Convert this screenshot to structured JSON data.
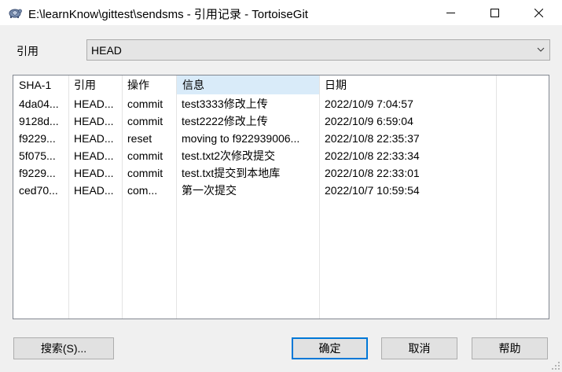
{
  "window": {
    "title": "E:\\learnKnow\\gittest\\sendsms - 引用记录 - TortoiseGit",
    "app_icon": "tortoise-icon"
  },
  "reference": {
    "label": "引用",
    "selected": "HEAD"
  },
  "columns": [
    "SHA-1",
    "引用",
    "操作",
    "信息",
    "日期"
  ],
  "rows": [
    {
      "sha": "4da04...",
      "ref": "HEAD...",
      "action": "commit",
      "message": "test3333修改上传",
      "date": "2022/10/9 7:04:57"
    },
    {
      "sha": "9128d...",
      "ref": "HEAD...",
      "action": "commit",
      "message": "test2222修改上传",
      "date": "2022/10/9 6:59:04"
    },
    {
      "sha": "f9229...",
      "ref": "HEAD...",
      "action": "reset",
      "message": "moving to f922939006...",
      "date": "2022/10/8 22:35:37"
    },
    {
      "sha": "5f075...",
      "ref": "HEAD...",
      "action": "commit",
      "message": "test.txt2次修改提交",
      "date": "2022/10/8 22:33:34"
    },
    {
      "sha": "f9229...",
      "ref": "HEAD...",
      "action": "commit",
      "message": "test.txt提交到本地库",
      "date": "2022/10/8 22:33:01"
    },
    {
      "sha": "ced70...",
      "ref": "HEAD...",
      "action": "com...",
      "message": "第一次提交",
      "date": "2022/10/7 10:59:54"
    }
  ],
  "buttons": {
    "search": "搜索(S)...",
    "ok": "确定",
    "cancel": "取消",
    "help": "帮助"
  }
}
